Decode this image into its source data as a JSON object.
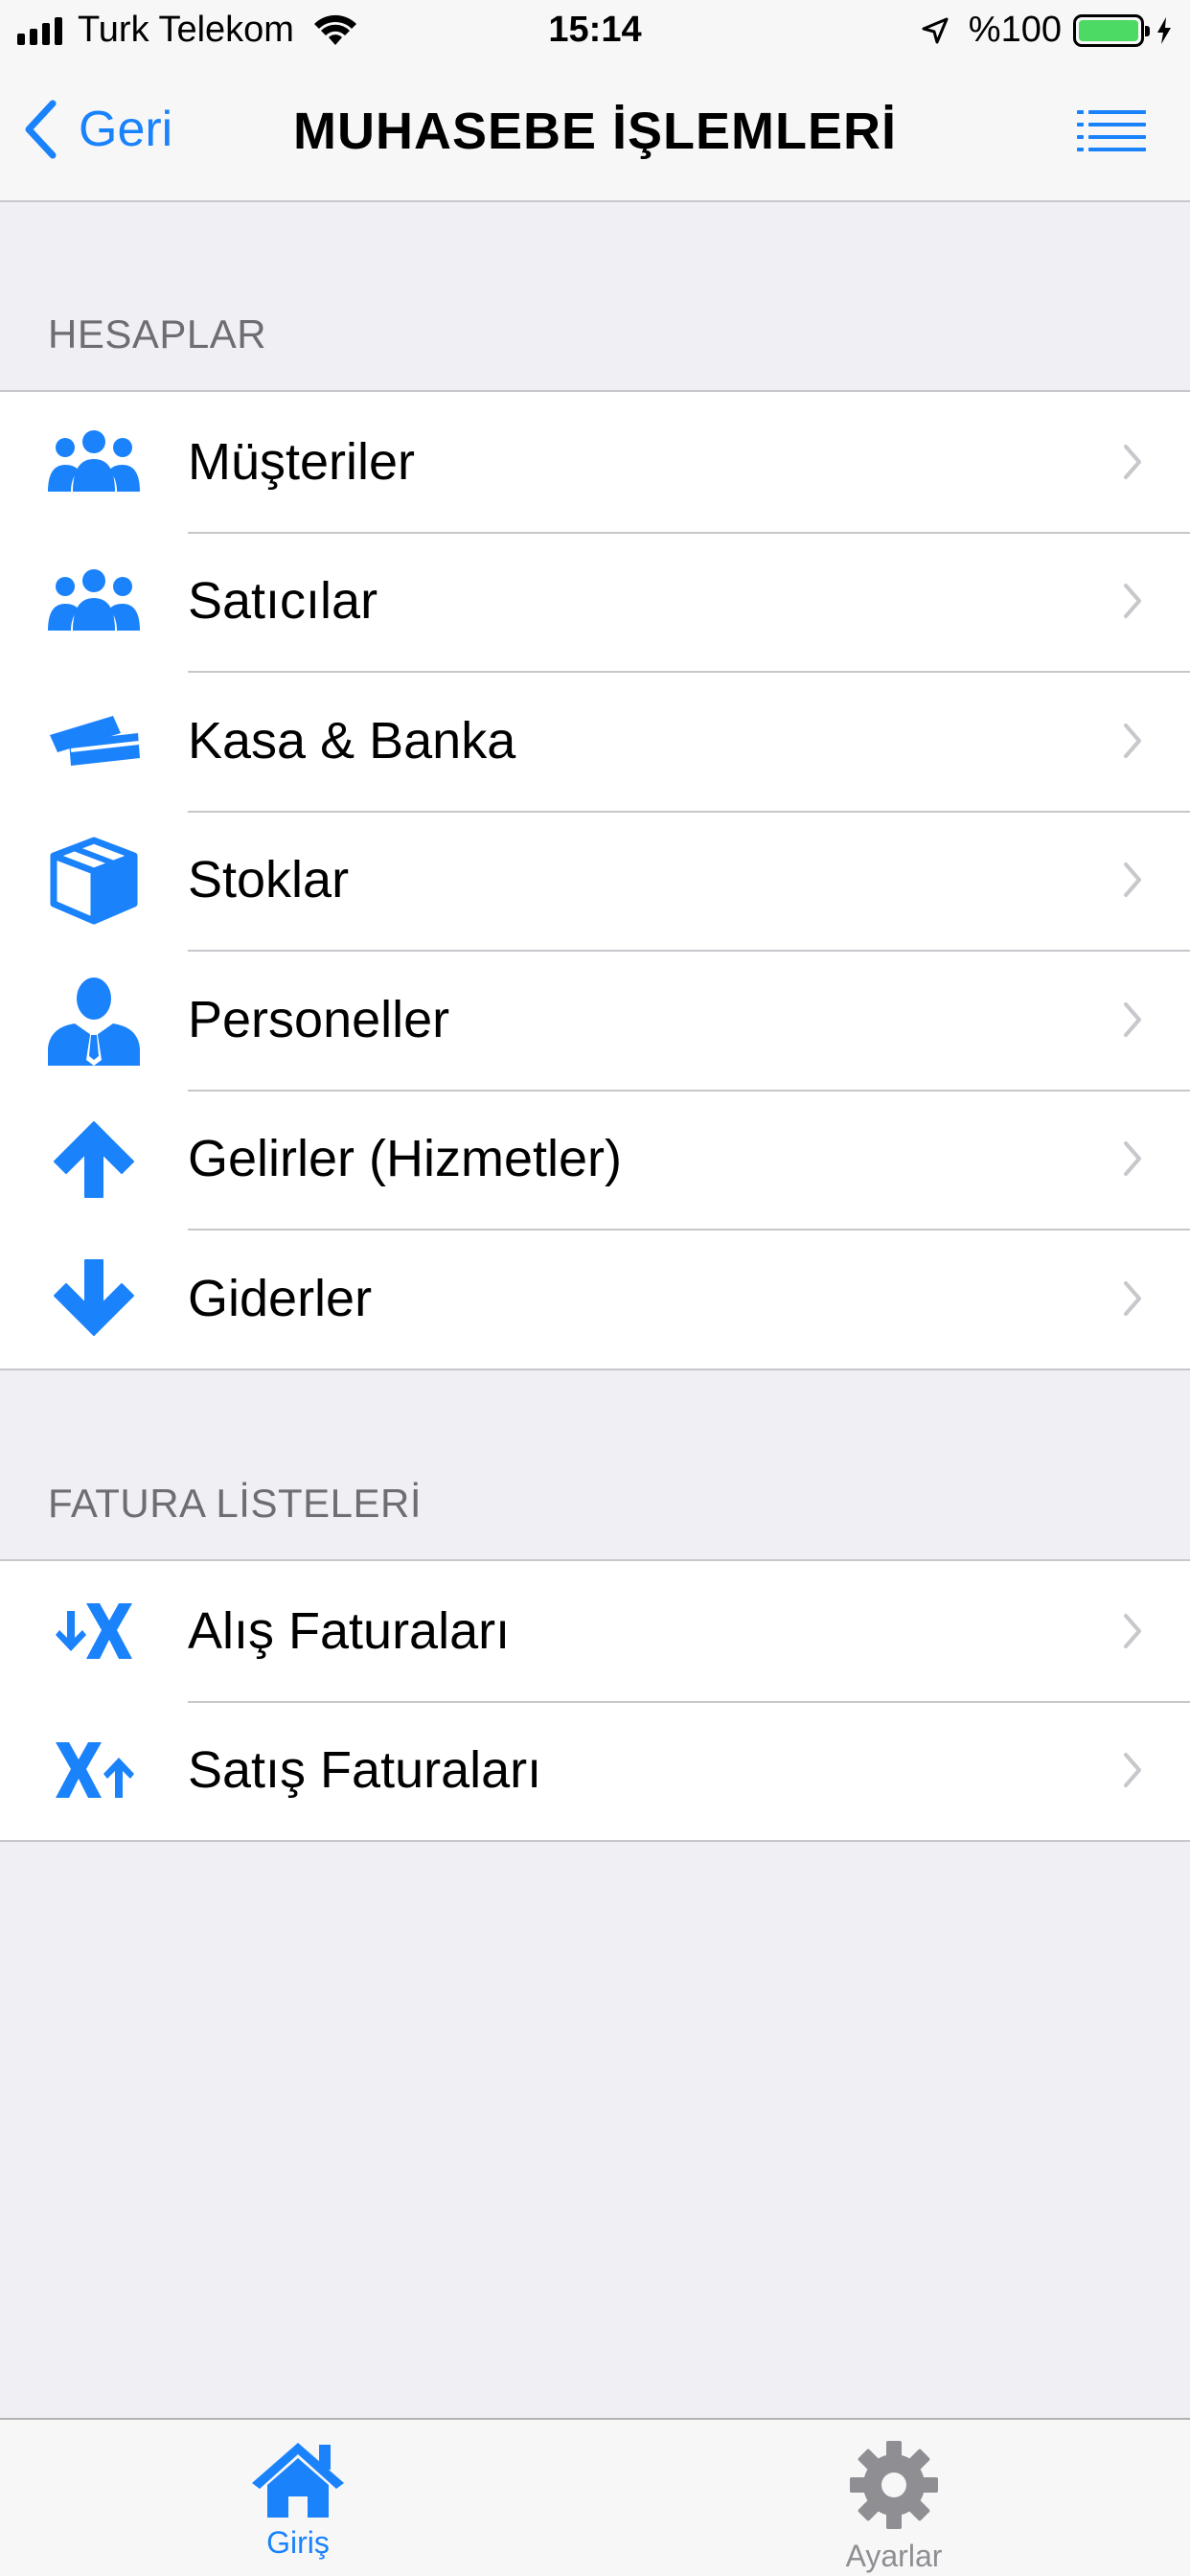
{
  "status_bar": {
    "carrier": "Turk Telekom",
    "time": "15:14",
    "battery": "%100"
  },
  "nav": {
    "back_label": "Geri",
    "title": "MUHASEBE İŞLEMLERİ"
  },
  "sections": [
    {
      "header": "HESAPLAR",
      "items": [
        {
          "label": "Müşteriler",
          "icon": "users-icon"
        },
        {
          "label": "Satıcılar",
          "icon": "users-icon"
        },
        {
          "label": "Kasa & Banka",
          "icon": "cards-icon"
        },
        {
          "label": "Stoklar",
          "icon": "box-icon"
        },
        {
          "label": "Personeller",
          "icon": "person-tie-icon"
        },
        {
          "label": "Gelirler (Hizmetler)",
          "icon": "arrow-up-icon"
        },
        {
          "label": "Giderler",
          "icon": "arrow-down-icon"
        }
      ]
    },
    {
      "header": "FATURA LİSTELERİ",
      "items": [
        {
          "label": "Alış Faturaları",
          "icon": "invoice-in-icon"
        },
        {
          "label": "Satış Faturaları",
          "icon": "invoice-out-icon"
        }
      ]
    }
  ],
  "tabs": [
    {
      "label": "Giriş",
      "icon": "home-icon",
      "active": true
    },
    {
      "label": "Ayarlar",
      "icon": "gear-icon",
      "active": false
    }
  ],
  "colors": {
    "accent": "#1a82fb",
    "battery": "#4cd964",
    "background": "#efeff4"
  }
}
